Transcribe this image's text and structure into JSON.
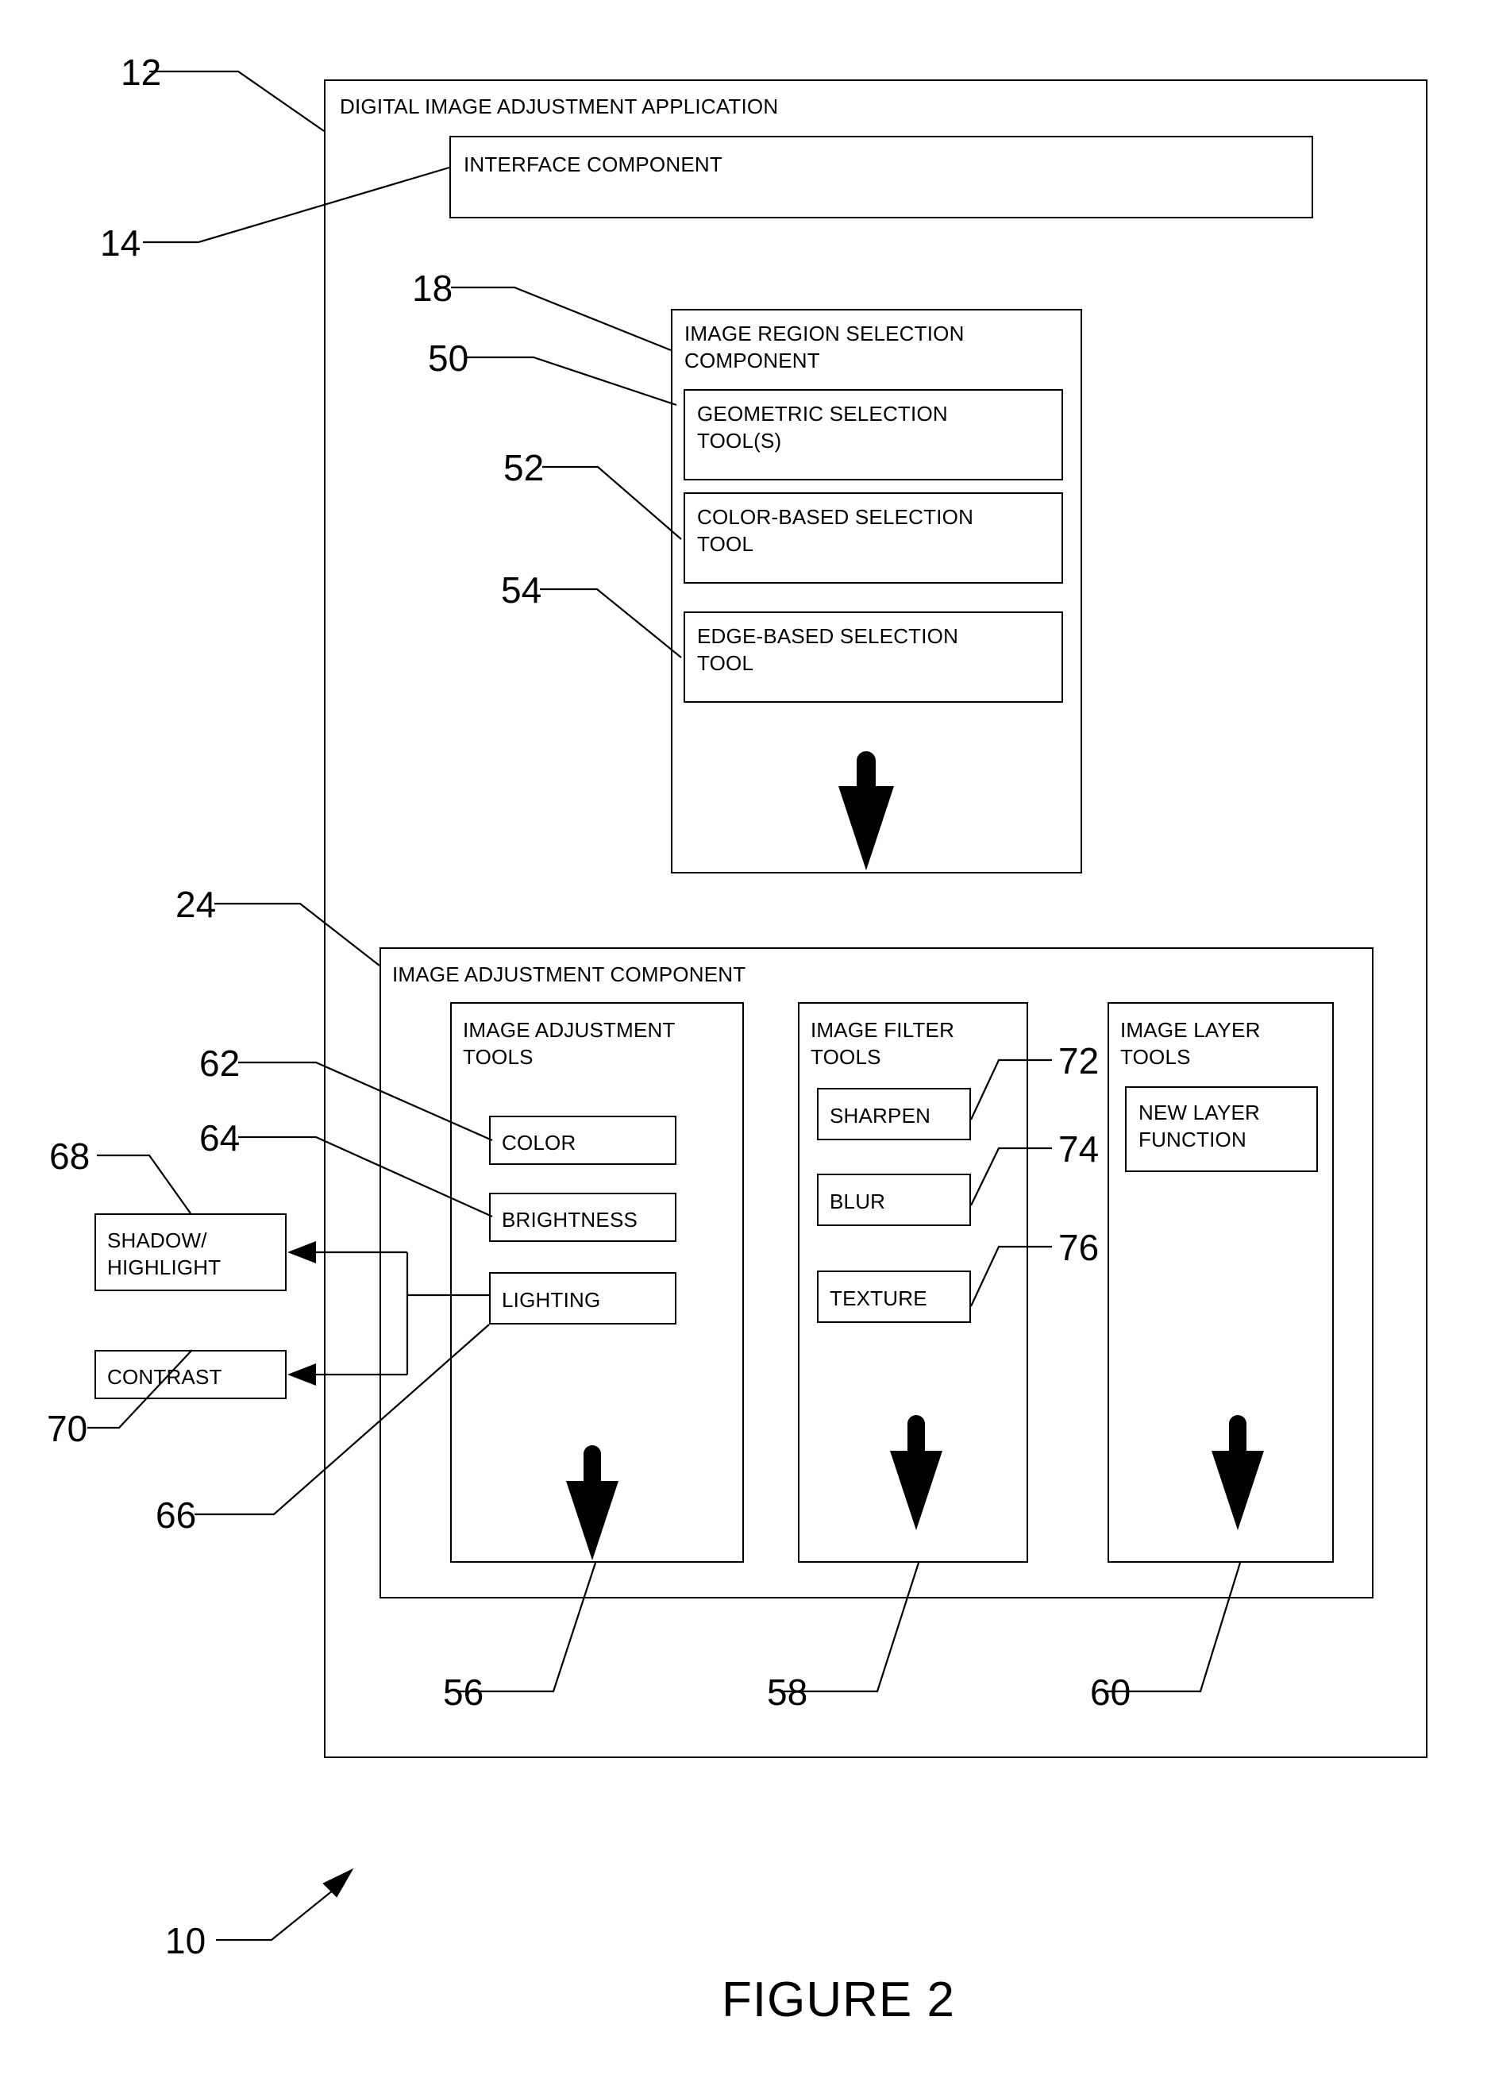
{
  "figure": {
    "caption": "FIGURE 2",
    "system_ref": "10"
  },
  "application": {
    "title": "DIGITAL IMAGE ADJUSTMENT APPLICATION",
    "ref": "12",
    "interface_component": {
      "label": "INTERFACE COMPONENT",
      "ref": "14"
    }
  },
  "region_selection": {
    "title": "IMAGE REGION SELECTION\nCOMPONENT",
    "ref": "18",
    "tools": [
      {
        "label": "GEOMETRIC  SELECTION\nTOOL(S)",
        "ref": "50"
      },
      {
        "label": "COLOR-BASED SELECTION\nTOOL",
        "ref": "52"
      },
      {
        "label": "EDGE-BASED SELECTION\nTOOL",
        "ref": "54"
      }
    ],
    "flow_arrow": "down-arrow"
  },
  "adjustment_component": {
    "title": "IMAGE ADJUSTMENT COMPONENT",
    "ref": "24",
    "columns": [
      {
        "title": "IMAGE ADJUSTMENT\nTOOLS",
        "ref": "56",
        "tools": [
          {
            "label": "COLOR",
            "ref": "62"
          },
          {
            "label": "BRIGHTNESS",
            "ref": "64"
          },
          {
            "label": "LIGHTING",
            "ref": "66"
          }
        ]
      },
      {
        "title": "IMAGE FILTER\nTOOLS",
        "ref": "58",
        "tools": [
          {
            "label": "SHARPEN",
            "ref": "72"
          },
          {
            "label": "BLUR",
            "ref": "74"
          },
          {
            "label": "TEXTURE",
            "ref": "76"
          }
        ]
      },
      {
        "title": "IMAGE LAYER\nTOOLS",
        "ref": "60",
        "tools": [
          {
            "label": "NEW LAYER\nFUNCTION",
            "ref": ""
          }
        ]
      }
    ]
  },
  "lighting_outputs": [
    {
      "label": "SHADOW/\nHIGHLIGHT",
      "ref": "68"
    },
    {
      "label": "CONTRAST",
      "ref": "70"
    }
  ],
  "colors": {
    "stroke": "#000000",
    "background": "#ffffff"
  }
}
